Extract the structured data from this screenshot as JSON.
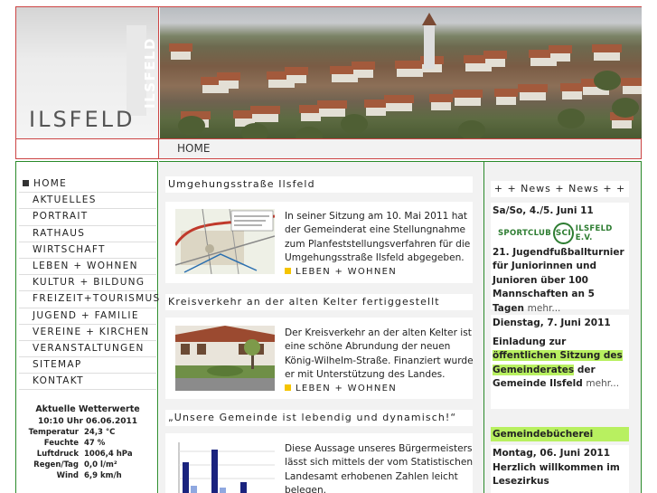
{
  "site": {
    "logo_vertical": "ILSFELD",
    "logo_text": "ILSFELD"
  },
  "breadcrumb": "HOME",
  "nav": [
    {
      "label": "HOME",
      "active": true
    },
    {
      "label": "AKTUELLES"
    },
    {
      "label": "PORTRAIT"
    },
    {
      "label": "RATHAUS"
    },
    {
      "label": "WIRTSCHAFT"
    },
    {
      "label": "LEBEN + WOHNEN"
    },
    {
      "label": "KULTUR + BILDUNG"
    },
    {
      "label": "FREIZEIT+TOURISMUS"
    },
    {
      "label": "JUGEND + FAMILIE"
    },
    {
      "label": "VEREINE + KIRCHEN"
    },
    {
      "label": "VERANSTALTUNGEN"
    },
    {
      "label": "SITEMAP"
    },
    {
      "label": "KONTAKT"
    }
  ],
  "weather": {
    "title": "Aktuelle Wetterwerte",
    "datetime": "10:10 Uhr 06.06.2011",
    "rows": [
      {
        "k": "Temperatur",
        "v": "24,3 °C"
      },
      {
        "k": "Feuchte",
        "v": "47 %"
      },
      {
        "k": "Luftdruck",
        "v": "1006,4 hPa"
      },
      {
        "k": "Regen/Tag",
        "v": "0,0 l/m²"
      },
      {
        "k": "Wind",
        "v": "6,9 km/h"
      }
    ]
  },
  "articles": [
    {
      "title": "Umgehungsstraße Ilsfeld",
      "thumb": "map",
      "text": "In seiner Sitzung am 10. Mai 2011 hat der Gemeinderat eine Stellungnahme zum Planfeststellungsverfahren für die Umgehungsstraße Ilsfeld abgegeben.",
      "more": "LEBEN + WOHNEN"
    },
    {
      "title": "Kreisverkehr an der alten Kelter fertiggestellt",
      "thumb": "photo",
      "text": "Der Kreisverkehr an der alten Kelter ist eine schöne Abrundung der neuen König-Wilhelm-Straße. Finanziert wurde er mit Unterstützung des Landes.",
      "more": "LEBEN + WOHNEN"
    },
    {
      "title": "„Unsere Gemeinde ist lebendig und dynamisch!“",
      "thumb": "chart",
      "text": "Diese Aussage unseres Bürgermeisters lässt sich mittels der vom Statistischen Landesamt erhobenen Zahlen leicht belegen."
    }
  ],
  "news": {
    "header": "+ + News + News + +",
    "item1": {
      "date": "Sa/So, 4./5. Juni 11",
      "logo_left": "SPORTCLUB",
      "logo_mid": "SCI",
      "logo_right": "ILSFELD E.V.",
      "text": "21. Jugendfußballturnier für Juniorinnen und Junioren über 100 Mannschaften an 5 Tagen",
      "more": "mehr..."
    },
    "item2": {
      "date": "Dienstag, 7. Juni 2011",
      "text_a": "Einladung zur ",
      "text_hl": "öffentlichen Sitzung des Gemeinderates",
      "text_b": " der Gemeinde Ilsfeld",
      "more": "mehr..."
    },
    "item3": {
      "category": "Gemeindebücherei",
      "date": "Montag, 06. Juni 2011",
      "text": "Herzlich willkommen im Lesezirkus"
    }
  }
}
